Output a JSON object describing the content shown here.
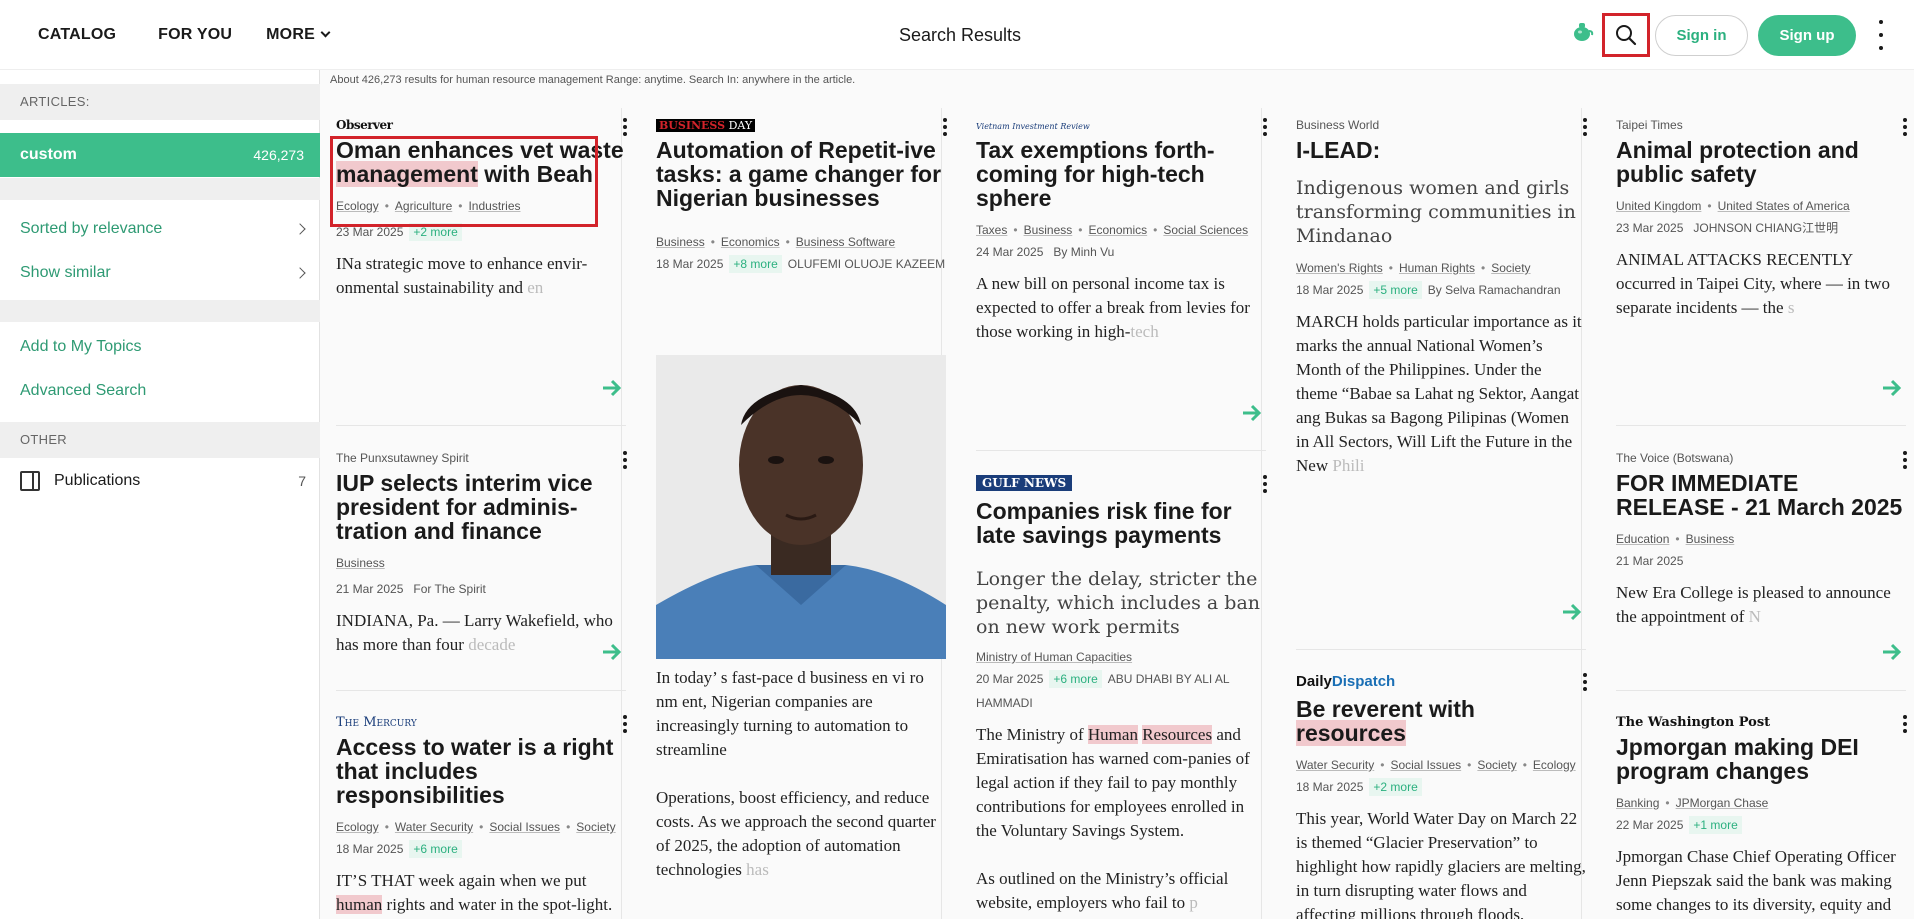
{
  "nav": {
    "catalog": "CATALOG",
    "for_you": "FOR YOU",
    "more": "MORE"
  },
  "page_title": "Search Results",
  "header": {
    "sign_in": "Sign in",
    "sign_up": "Sign up"
  },
  "sidebar": {
    "articles_head": "ARTICLES:",
    "custom_label": "custom",
    "custom_count": "426,273",
    "sorted": "Sorted by relevance",
    "show_similar": "Show similar",
    "add_topics": "Add to My Topics",
    "advanced": "Advanced Search",
    "other_head": "OTHER",
    "publications": "Publications",
    "publications_count": "7"
  },
  "summary": "About 426,273 results for human resource management Range: anytime. Search In: anywhere in the article.",
  "colors": {
    "accent": "#3dbe8b",
    "highlight": "#f1c9cd",
    "annotation_box": "#d2232a"
  },
  "cards": {
    "c1": {
      "source": "Observer",
      "title_a": "Oman enhances vet waste ",
      "title_b": "management",
      "title_c": " with Beah",
      "tags": [
        "Ecology",
        "Agriculture",
        "Industries"
      ],
      "date": "23 Mar 2025",
      "more": "+2 more",
      "body": "INa strategic move to enhance envir-onmental sustainability and en"
    },
    "c2": {
      "source": "The Punxsutawney Spirit",
      "title": "IUP selects interim vice president for adminis-tration and finance",
      "tags": [
        "Business"
      ],
      "date": "21 Mar 2025",
      "author": "For The Spirit",
      "body": "INDIANA, Pa. — Larry Wakefield, who has more than four decade"
    },
    "c3": {
      "source": "The Mercury",
      "title": "Access to water is a right that includes responsibilities",
      "tags": [
        "Ecology",
        "Water Security",
        "Social Issues",
        "Society"
      ],
      "date": "18 Mar 2025",
      "more": "+6 more",
      "body_a": "IT’S THAT week again when we put ",
      "body_hl": "human",
      "body_b": " rights and water in the spot-light. As a country, we celebrate"
    },
    "c4": {
      "source_a": "BUSINESS",
      "source_b": "DAY",
      "title": "Automation of Repetit-ive tasks: a game changer for Nigerian businesses",
      "tags": [
        "Business",
        "Economics",
        "Business Software"
      ],
      "date": "18 Mar 2025",
      "more": "+8 more",
      "author": "OLUFEMI OLUOJE KAZEEM",
      "body1": "In today’ s fast-pace d business en vi ro nm ent, Nigerian companies are increasingly turning to automation to streamline",
      "body2": "Operations, boost efficiency, and reduce costs. As we approach the second quarter of 2025, the adoption of automation technologies has"
    },
    "c5": {
      "source": "Vietnam Investment Review",
      "title": "Tax exemptions forth-coming for high-tech sphere",
      "tags": [
        "Taxes",
        "Business",
        "Economics",
        "Social Sciences"
      ],
      "date": "24 Mar 2025",
      "author": "By Minh Vu",
      "body": "A new bill on personal income tax is expected to offer a break from levies for those working in high-tech"
    },
    "c6": {
      "source": "GULF NEWS",
      "title": "Companies risk fine for late savings payments",
      "subhead": "Longer the delay, stricter the penalty, which includes a ban on new work permits",
      "tags": [
        "Ministry of Human Capacities"
      ],
      "date": "20 Mar 2025",
      "more": "+6 more",
      "author": "ABU DHABI BY ALI AL HAMMADI",
      "body_a": "The Ministry of ",
      "body_hl1": "Human",
      "body_hl2": "Resources",
      "body_b": " and Emiratisation has warned com-panies of legal action if they fail to pay monthly contributions for employees enrolled in the Voluntary Savings System.",
      "body2": "As outlined on the Ministry’s official website, employers who fail to p"
    },
    "c7": {
      "source": "Business World",
      "title": "I-LEAD:",
      "subhead": "Indigenous women and girls transforming communities in Mindanao",
      "tags": [
        "Women's Rights",
        "Human Rights",
        "Society"
      ],
      "date": "18 Mar 2025",
      "more": "+5 more",
      "author": "By Selva Ramachandran",
      "body": "MARCH holds particular importance as it marks the annual National Women’s Month of the Philippines. Under the theme “Babae sa Lahat ng Sektor, Aangat ang Bukas sa Bagong Pilipinas (Women in All Sectors, Will Lift the Future in the New Phili"
    },
    "c8": {
      "source_a": "Daily",
      "source_b": "Dispatch",
      "title_a": "Be reverent with ",
      "title_hl": "resources",
      "tags": [
        "Water Security",
        "Social Issues",
        "Society",
        "Ecology"
      ],
      "date": "18 Mar 2025",
      "more": "+2 more",
      "body": "This year, World Water Day on March 22 is themed “Glacier Preservation” to highlight how rapidly glaciers are melting, in turn disrupting water flows and affecting millions through floods, droughts, and rising sea levels."
    },
    "c9": {
      "source": "Taipei Times",
      "title": "Animal protection and public safety",
      "tags": [
        "United Kingdom",
        "United States of America"
      ],
      "date": "23 Mar 2025",
      "author": "JOHNSON CHIANG江世明",
      "body": "ANIMAL ATTACKS RECENTLY occurred in Taipei City, where — in two separate incidents — the s"
    },
    "c10": {
      "source": "The Voice (Botswana)",
      "title": "FOR IMMEDIATE RELEASE - 21 March 2025",
      "tags": [
        "Education",
        "Business"
      ],
      "date": "21 Mar 2025",
      "body": "New Era College is pleased to announce the appointment of N"
    },
    "c11": {
      "source": "The Washington Post",
      "title": "Jpmorgan making DEI program changes",
      "tags": [
        "Banking",
        "JPMorgan Chase"
      ],
      "date": "22 Mar 2025",
      "more": "+1 more",
      "body": "Jpmorgan Chase Chief Operating Officer Jenn Piepszak said the bank was making some changes to its diversity, equity and inclusion p"
    }
  }
}
